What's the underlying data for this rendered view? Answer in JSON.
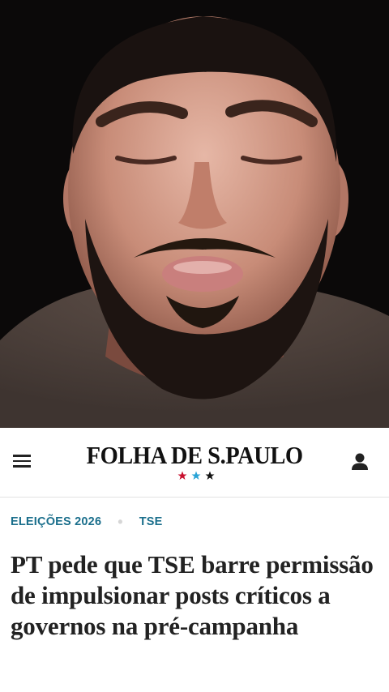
{
  "video": {
    "description_icon": "video-frame"
  },
  "masthead": {
    "logo_text": "FOLHA DE S.PAULO",
    "star_colors": [
      "#c8102e",
      "#29a3d6",
      "#111111"
    ],
    "menu_icon": "hamburger-menu-icon",
    "user_icon": "user-account-icon"
  },
  "article": {
    "tags": [
      "ELEIÇÕES 2026",
      "TSE"
    ],
    "headline": "PT pede que TSE barre permissão de impulsionar posts críticos a governos na pré-campanha"
  },
  "colors": {
    "tag": "#1b6f8c",
    "headline": "#222222",
    "accent_red": "#c8102e",
    "accent_blue": "#29a3d6"
  }
}
